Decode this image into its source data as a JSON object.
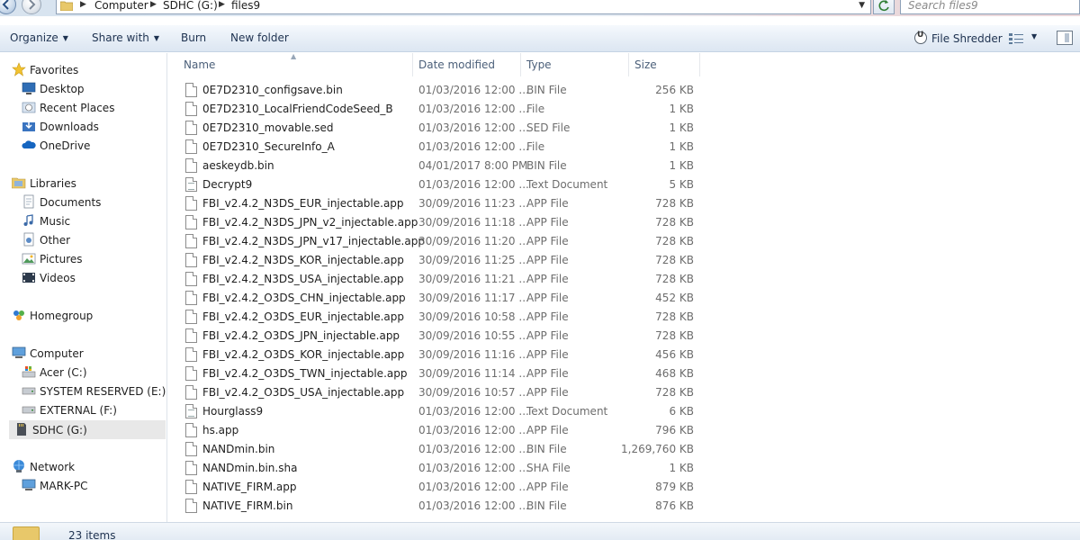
{
  "address_bar": {
    "breadcrumbs": [
      "Computer",
      "SDHC (G:)",
      "files9"
    ],
    "search_placeholder": "Search files9"
  },
  "toolbar": {
    "organize": "Organize",
    "share_with": "Share with",
    "burn": "Burn",
    "new_folder": "New folder",
    "file_shredder": "File Shredder"
  },
  "nav": {
    "favorites": {
      "label": "Favorites",
      "items": [
        "Desktop",
        "Recent Places",
        "Downloads",
        "OneDrive"
      ]
    },
    "libraries": {
      "label": "Libraries",
      "items": [
        "Documents",
        "Music",
        "Other",
        "Pictures",
        "Videos"
      ]
    },
    "homegroup": {
      "label": "Homegroup"
    },
    "computer": {
      "label": "Computer",
      "items": [
        "Acer (C:)",
        "SYSTEM RESERVED (E:)",
        "EXTERNAL (F:)",
        "SDHC (G:)"
      ],
      "selected": "SDHC (G:)"
    },
    "network": {
      "label": "Network",
      "items": [
        "MARK-PC"
      ]
    }
  },
  "columns": {
    "name": "Name",
    "date": "Date modified",
    "type": "Type",
    "size": "Size"
  },
  "files": [
    {
      "name": "0E7D2310_configsave.bin",
      "date": "01/03/2016 12:00 ...",
      "type": "BIN File",
      "size": "256 KB",
      "icon": "file-icon"
    },
    {
      "name": "0E7D2310_LocalFriendCodeSeed_B",
      "date": "01/03/2016 12:00 ...",
      "type": "File",
      "size": "1 KB",
      "icon": "file-icon"
    },
    {
      "name": "0E7D2310_movable.sed",
      "date": "01/03/2016 12:00 ...",
      "type": "SED File",
      "size": "1 KB",
      "icon": "file-icon"
    },
    {
      "name": "0E7D2310_SecureInfo_A",
      "date": "01/03/2016 12:00 ...",
      "type": "File",
      "size": "1 KB",
      "icon": "file-icon"
    },
    {
      "name": "aeskeydb.bin",
      "date": "04/01/2017 8:00 PM",
      "type": "BIN File",
      "size": "1 KB",
      "icon": "file-icon"
    },
    {
      "name": "Decrypt9",
      "date": "01/03/2016 12:00 ...",
      "type": "Text Document",
      "size": "5 KB",
      "icon": "text-file-icon"
    },
    {
      "name": "FBI_v2.4.2_N3DS_EUR_injectable.app",
      "date": "30/09/2016 11:23 ...",
      "type": "APP File",
      "size": "728 KB",
      "icon": "file-icon"
    },
    {
      "name": "FBI_v2.4.2_N3DS_JPN_v2_injectable.app",
      "date": "30/09/2016 11:18 ...",
      "type": "APP File",
      "size": "728 KB",
      "icon": "file-icon"
    },
    {
      "name": "FBI_v2.4.2_N3DS_JPN_v17_injectable.app",
      "date": "30/09/2016 11:20 ...",
      "type": "APP File",
      "size": "728 KB",
      "icon": "file-icon"
    },
    {
      "name": "FBI_v2.4.2_N3DS_KOR_injectable.app",
      "date": "30/09/2016 11:25 ...",
      "type": "APP File",
      "size": "728 KB",
      "icon": "file-icon"
    },
    {
      "name": "FBI_v2.4.2_N3DS_USA_injectable.app",
      "date": "30/09/2016 11:21 ...",
      "type": "APP File",
      "size": "728 KB",
      "icon": "file-icon"
    },
    {
      "name": "FBI_v2.4.2_O3DS_CHN_injectable.app",
      "date": "30/09/2016 11:17 ...",
      "type": "APP File",
      "size": "452 KB",
      "icon": "file-icon"
    },
    {
      "name": "FBI_v2.4.2_O3DS_EUR_injectable.app",
      "date": "30/09/2016 10:58 ...",
      "type": "APP File",
      "size": "728 KB",
      "icon": "file-icon"
    },
    {
      "name": "FBI_v2.4.2_O3DS_JPN_injectable.app",
      "date": "30/09/2016 10:55 ...",
      "type": "APP File",
      "size": "728 KB",
      "icon": "file-icon"
    },
    {
      "name": "FBI_v2.4.2_O3DS_KOR_injectable.app",
      "date": "30/09/2016 11:16 ...",
      "type": "APP File",
      "size": "456 KB",
      "icon": "file-icon"
    },
    {
      "name": "FBI_v2.4.2_O3DS_TWN_injectable.app",
      "date": "30/09/2016 11:14 ...",
      "type": "APP File",
      "size": "468 KB",
      "icon": "file-icon"
    },
    {
      "name": "FBI_v2.4.2_O3DS_USA_injectable.app",
      "date": "30/09/2016 10:57 ...",
      "type": "APP File",
      "size": "728 KB",
      "icon": "file-icon"
    },
    {
      "name": "Hourglass9",
      "date": "01/03/2016 12:00 ...",
      "type": "Text Document",
      "size": "6 KB",
      "icon": "text-file-icon"
    },
    {
      "name": "hs.app",
      "date": "01/03/2016 12:00 ...",
      "type": "APP File",
      "size": "796 KB",
      "icon": "file-icon"
    },
    {
      "name": "NANDmin.bin",
      "date": "01/03/2016 12:00 ...",
      "type": "BIN File",
      "size": "1,269,760 KB",
      "icon": "file-icon"
    },
    {
      "name": "NANDmin.bin.sha",
      "date": "01/03/2016 12:00 ...",
      "type": "SHA File",
      "size": "1 KB",
      "icon": "file-icon"
    },
    {
      "name": "NATIVE_FIRM.app",
      "date": "01/03/2016 12:00 ...",
      "type": "APP File",
      "size": "879 KB",
      "icon": "file-icon"
    },
    {
      "name": "NATIVE_FIRM.bin",
      "date": "01/03/2016 12:00 ...",
      "type": "BIN File",
      "size": "876 KB",
      "icon": "file-icon"
    }
  ],
  "status": {
    "count": "23 items"
  }
}
